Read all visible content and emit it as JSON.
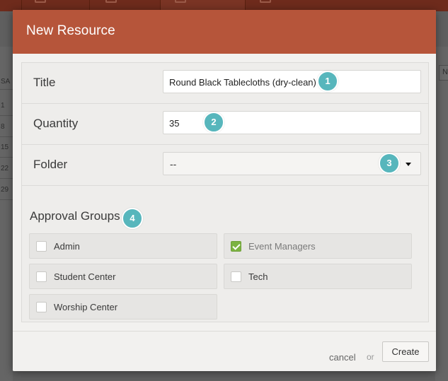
{
  "background": {
    "gutter_labels": [
      "SA",
      "1",
      "8",
      "15",
      "22",
      "29"
    ],
    "right_strip_label": "N"
  },
  "modal": {
    "title": "New Resource",
    "fields": {
      "title_label": "Title",
      "title_value": "Round Black Tablecloths (dry-clean)",
      "quantity_label": "Quantity",
      "quantity_value": "35",
      "folder_label": "Folder",
      "folder_selected": "--"
    },
    "approval_groups": {
      "label": "Approval Groups",
      "items": [
        {
          "label": "Admin",
          "checked": false
        },
        {
          "label": "Event Managers",
          "checked": true
        },
        {
          "label": "Student Center",
          "checked": false
        },
        {
          "label": "Tech",
          "checked": false
        },
        {
          "label": "Worship Center",
          "checked": false
        }
      ]
    },
    "footer": {
      "cancel_label": "cancel",
      "or_label": "or",
      "create_label": "Create"
    },
    "callouts": [
      "1",
      "2",
      "3",
      "4"
    ]
  },
  "colors": {
    "header": "#b6553a",
    "badge": "#57b6bc",
    "checkbox_checked": "#7cb342"
  }
}
